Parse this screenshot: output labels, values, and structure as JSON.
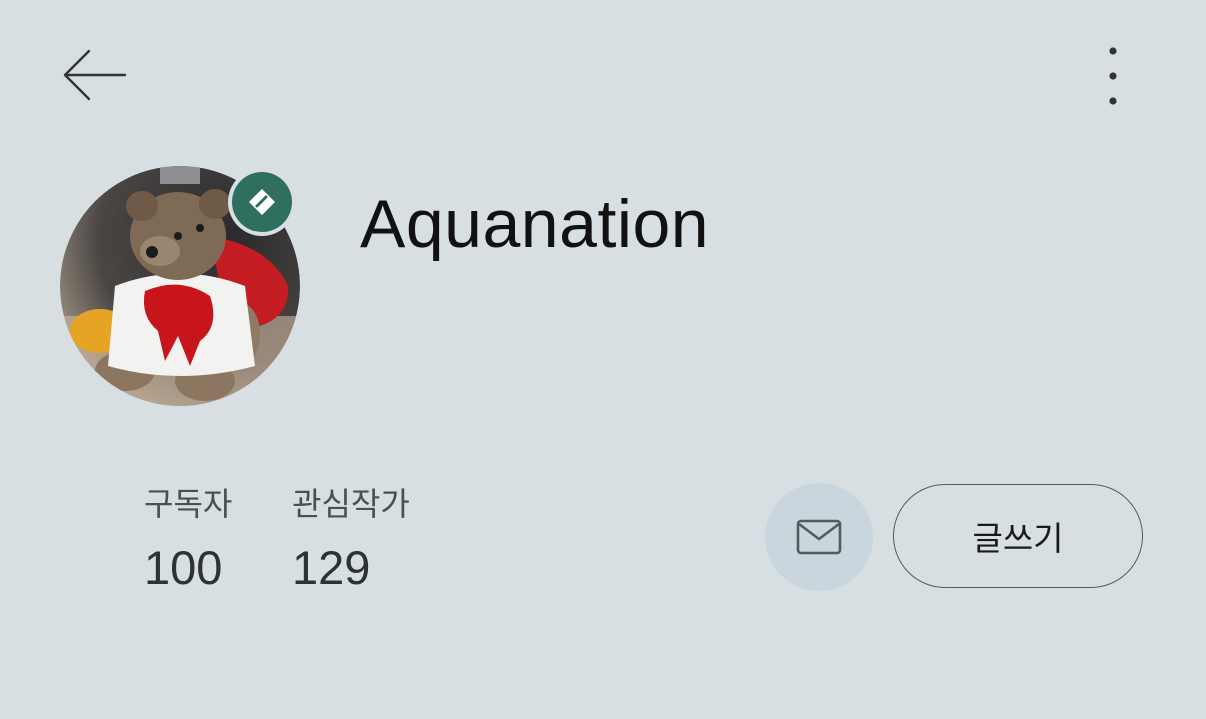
{
  "header": {
    "back_icon": "arrow-left-icon",
    "more_icon": "more-vertical-icon"
  },
  "profile": {
    "username": "Aquanation",
    "avatar_description": "teddy-bear-avatar",
    "badge_icon": "author-badge-icon",
    "badge_color": "#2f6f5f"
  },
  "stats": {
    "subscribers_label": "구독자",
    "subscribers_value": "100",
    "following_label": "관심작가",
    "following_value": "129"
  },
  "actions": {
    "mail_icon": "envelope-icon",
    "write_label": "글쓰기"
  },
  "colors": {
    "background": "#d7dfe2",
    "mail_button_bg": "#c9d6dd"
  }
}
